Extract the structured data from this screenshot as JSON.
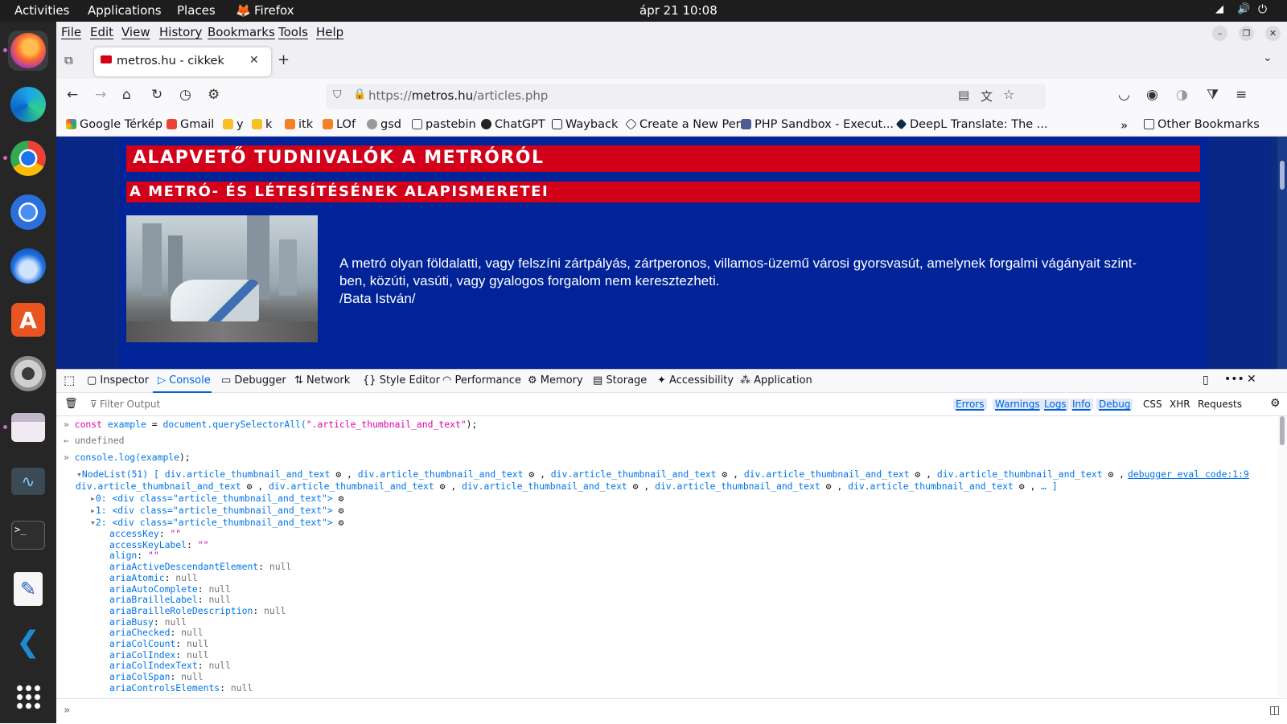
{
  "topbar": {
    "activities": "Activities",
    "applications": "Applications",
    "places": "Places",
    "app": "Firefox",
    "clock": "ápr 21  10:08"
  },
  "menu": {
    "file": "File",
    "edit": "Edit",
    "view": "View",
    "history": "History",
    "bookmarks": "Bookmarks",
    "tools": "Tools",
    "help": "Help"
  },
  "tab": {
    "title": "metros.hu - cikkek"
  },
  "url": {
    "prefix": "https://",
    "domain": "metros.hu",
    "path": "/articles.php"
  },
  "bookmarks": {
    "items": [
      "Google Térkép",
      "Gmail",
      "y",
      "k",
      "itk",
      "LOf",
      "gsd",
      "pastebin",
      "ChatGPT",
      "Wayback",
      "Create a New Pen",
      "PHP Sandbox - Execut...",
      "DeepL Translate: The ..."
    ],
    "other": "Other Bookmarks"
  },
  "article": {
    "h1": "Alapvető tudnivalók a metróról",
    "h2": "A metró- és létesítésének alapismeretei",
    "line1": "A metró olyan földalatti, vagy felszíni zártpályás, zártperonos, villamos-üzemű városi gyorsvasút, amelynek forgalmi vágányait szint-",
    "line2": "ben, közúti, vasúti, vagy gyalogos forgalom nem keresztezheti.",
    "line3": "/Bata István/"
  },
  "devtools": {
    "tabs": [
      "Inspector",
      "Console",
      "Debugger",
      "Network",
      "Style Editor",
      "Performance",
      "Memory",
      "Storage",
      "Accessibility",
      "Application"
    ],
    "filter_placeholder": "Filter Output",
    "filters": [
      "Errors",
      "Warnings",
      "Logs",
      "Info",
      "Debug"
    ],
    "filters2": [
      "CSS",
      "XHR",
      "Requests"
    ],
    "source": "debugger eval code:1:9"
  },
  "console": {
    "cmd1": {
      "kw": "const",
      "var": "example",
      "eq": " = ",
      "fn": "document.querySelectorAll(",
      "str": "\".article_thumbnail_and_text\"",
      "end": ");"
    },
    "res1": "undefined",
    "cmd2": {
      "fn": "console.log(",
      "var": "example",
      "end": ");"
    },
    "nodelist_head": "NodeList(51) [ ",
    "nodelist_item": "div.article_thumbnail_and_text",
    "nodelist_tail": "… ]",
    "rows": [
      {
        "idx": "0:",
        "el": "<div class=\"article_thumbnail_and_text\">"
      },
      {
        "idx": "1:",
        "el": "<div class=\"article_thumbnail_and_text\">"
      },
      {
        "idx": "2:",
        "el": "<div class=\"article_thumbnail_and_text\">"
      }
    ],
    "props": [
      {
        "k": "accessKey",
        "v": "\"\""
      },
      {
        "k": "accessKeyLabel",
        "v": "\"\""
      },
      {
        "k": "align",
        "v": "\"\""
      },
      {
        "k": "ariaActiveDescendantElement",
        "v": "null"
      },
      {
        "k": "ariaAtomic",
        "v": "null"
      },
      {
        "k": "ariaAutoComplete",
        "v": "null"
      },
      {
        "k": "ariaBrailleLabel",
        "v": "null"
      },
      {
        "k": "ariaBrailleRoleDescription",
        "v": "null"
      },
      {
        "k": "ariaBusy",
        "v": "null"
      },
      {
        "k": "ariaChecked",
        "v": "null"
      },
      {
        "k": "ariaColCount",
        "v": "null"
      },
      {
        "k": "ariaColIndex",
        "v": "null"
      },
      {
        "k": "ariaColIndexText",
        "v": "null"
      },
      {
        "k": "ariaColSpan",
        "v": "null"
      },
      {
        "k": "ariaControlsElements",
        "v": "null"
      }
    ]
  }
}
